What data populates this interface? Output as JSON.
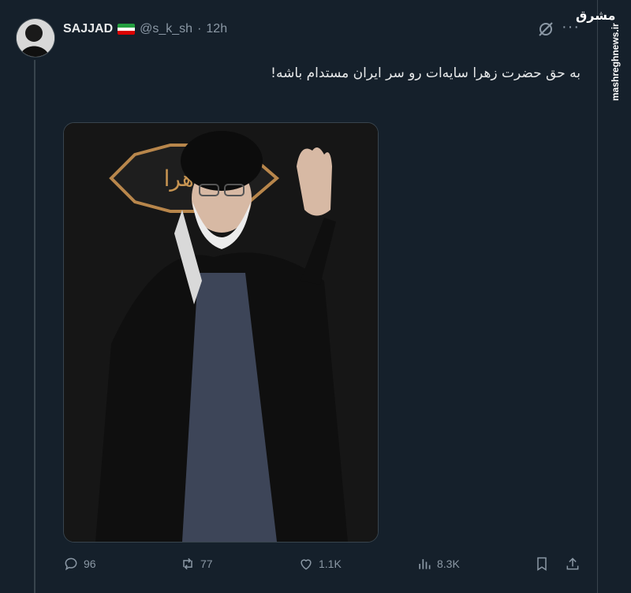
{
  "tweet": {
    "author_name": "SAJJAD",
    "handle": "@s_k_sh",
    "separator": "·",
    "time": "12h",
    "text": "به حق حضرت زهرا سایه‌ات رو سر ایران مستدام باشه!",
    "media_caption": "یا زهرا"
  },
  "actions": {
    "replies": "96",
    "retweets": "77",
    "likes": "1.1K",
    "views": "8.3K"
  },
  "watermark": {
    "logo": "مشرق",
    "site": "mashreghnews.ir"
  },
  "colors": {
    "background": "#15202b",
    "muted": "#8b98a5",
    "text": "#e7e9ea",
    "border": "#38444d"
  },
  "icons": [
    "grok-icon",
    "more-icon",
    "reply-icon",
    "retweet-icon",
    "like-icon",
    "views-icon",
    "bookmark-icon",
    "share-icon",
    "iran-flag-icon"
  ]
}
